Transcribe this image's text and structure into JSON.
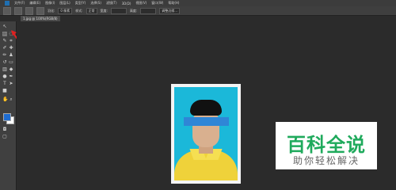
{
  "menubar": {
    "logo": "Ps",
    "items": [
      "文件(F)",
      "编辑(E)",
      "图像(I)",
      "图层(L)",
      "类型(Y)",
      "选择(S)",
      "滤镜(T)",
      "3D(D)",
      "视图(V)",
      "窗口(W)",
      "帮助(H)"
    ]
  },
  "options": {
    "feather_label": "羽化:",
    "feather_value": "0 像素",
    "style_label": "样式:",
    "style_value": "正常",
    "width_label": "宽度:",
    "height_label": "高度:",
    "refine_label": "调整边缘..."
  },
  "document": {
    "tab_title": "1.jpg @ 100%(RGB/8)"
  },
  "colors": {
    "foreground": "#1e6cd1",
    "background": "#ffffff",
    "arrow": "#e02020",
    "watermark_green": "#1faa5c"
  },
  "watermark": {
    "title": "百科全说",
    "subtitle": "助你轻松解决"
  }
}
